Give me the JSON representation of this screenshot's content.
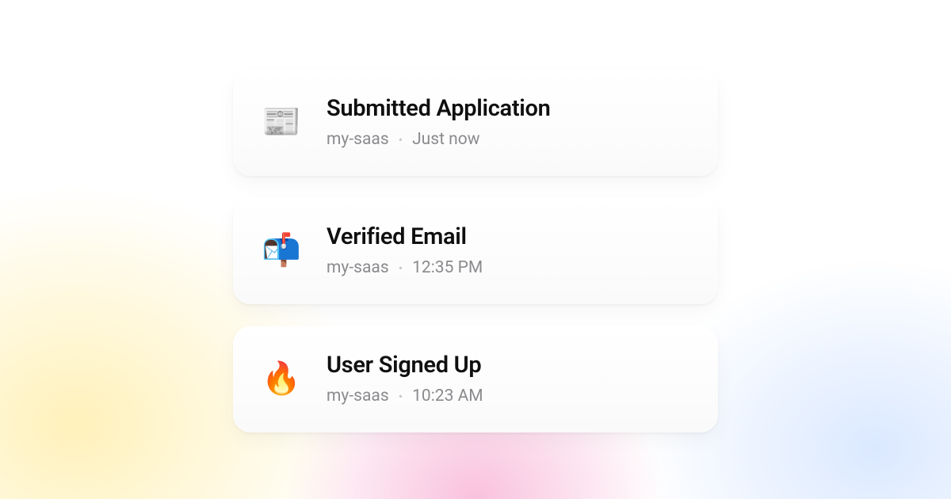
{
  "notifications": [
    {
      "icon": "📰",
      "title": "Submitted Application",
      "source": "my-saas",
      "time": "Just now"
    },
    {
      "icon": "📬",
      "title": "Verified Email",
      "source": "my-saas",
      "time": "12:35 PM"
    },
    {
      "icon": "🔥",
      "title": "User Signed Up",
      "source": "my-saas",
      "time": "10:23 AM"
    }
  ]
}
